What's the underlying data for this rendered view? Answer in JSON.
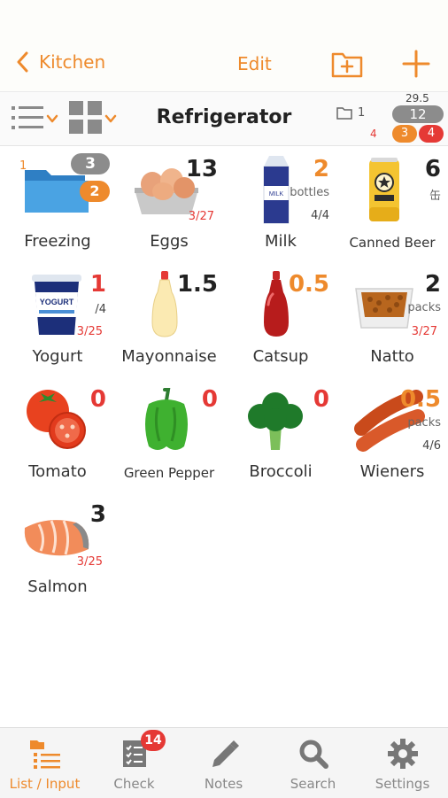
{
  "nav": {
    "back_label": "Kitchen",
    "edit_label": "Edit"
  },
  "bar": {
    "title": "Refrigerator",
    "folder_count": "1",
    "summary_sub": "29.5",
    "summary_total": "12",
    "summary_red_text": "4",
    "summary_orange": "3",
    "summary_red": "4"
  },
  "items": [
    {
      "name": "Freezing",
      "type": "folder",
      "small": "1",
      "count": "3",
      "badge": "2"
    },
    {
      "name": "Eggs",
      "qty": "13",
      "date": "3/27",
      "icon": "eggs-icon"
    },
    {
      "name": "Milk",
      "qty": "2",
      "unit": "bottles",
      "frac": "4/4",
      "icon": "milk-icon"
    },
    {
      "name": "Canned Beer",
      "qty": "6",
      "unit": "缶",
      "icon": "beer-can-icon"
    },
    {
      "name": "Yogurt",
      "qty": "1",
      "frac": "/4",
      "date": "3/25",
      "icon": "yogurt-icon"
    },
    {
      "name": "Mayonnaise",
      "qty": "1.5",
      "icon": "mayonnaise-icon"
    },
    {
      "name": "Catsup",
      "qty": "0.5",
      "icon": "catsup-icon"
    },
    {
      "name": "Natto",
      "qty": "2",
      "unit": "packs",
      "date": "3/27",
      "icon": "natto-icon"
    },
    {
      "name": "Tomato",
      "qty": "0",
      "icon": "tomato-icon"
    },
    {
      "name": "Green Pepper",
      "qty": "0",
      "icon": "green-pepper-icon"
    },
    {
      "name": "Broccoli",
      "qty": "0",
      "icon": "broccoli-icon"
    },
    {
      "name": "Wieners",
      "qty": "0.5",
      "unit": "packs",
      "frac": "4/6",
      "icon": "wieners-icon"
    },
    {
      "name": "Salmon",
      "qty": "3",
      "date": "3/25",
      "icon": "salmon-icon"
    }
  ],
  "tabs": [
    {
      "label": "List / Input",
      "icon": "list-input-icon"
    },
    {
      "label": "Check",
      "icon": "checklist-icon",
      "badge": "14"
    },
    {
      "label": "Notes",
      "icon": "pencil-icon"
    },
    {
      "label": "Search",
      "icon": "search-icon"
    },
    {
      "label": "Settings",
      "icon": "gear-icon"
    }
  ],
  "colors": {
    "accent": "#ee8a2c",
    "alert": "#e53935",
    "badge_gray": "#8c8c8c"
  }
}
